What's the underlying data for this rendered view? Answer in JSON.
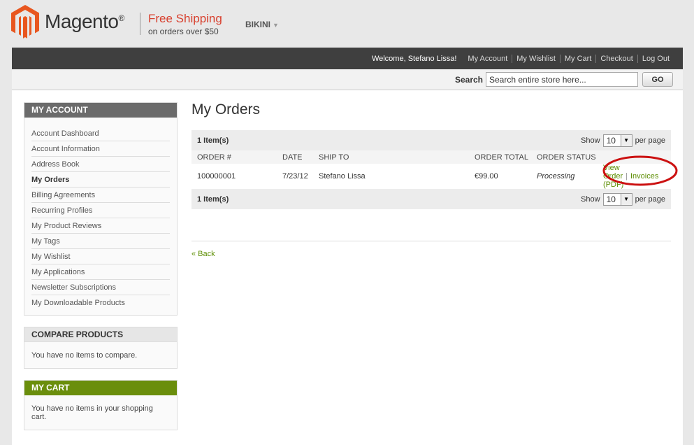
{
  "brand": {
    "name": "Magento",
    "reg": "®"
  },
  "promo": {
    "title": "Free Shipping",
    "subtitle": "on orders over $50"
  },
  "store_switcher": {
    "value": "BIKINI"
  },
  "topbar": {
    "welcome": "Welcome, Stefano Lissa!",
    "links": [
      "My Account",
      "My Wishlist",
      "My Cart",
      "Checkout",
      "Log Out"
    ]
  },
  "search": {
    "label": "Search",
    "placeholder": "Search entire store here...",
    "value": "Search entire store here...",
    "button": "GO"
  },
  "sidebar": {
    "account_title": "MY ACCOUNT",
    "account_items": [
      "Account Dashboard",
      "Account Information",
      "Address Book",
      "My Orders",
      "Billing Agreements",
      "Recurring Profiles",
      "My Product Reviews",
      "My Tags",
      "My Wishlist",
      "My Applications",
      "Newsletter Subscriptions",
      "My Downloadable Products"
    ],
    "active_item": "My Orders",
    "compare": {
      "title": "COMPARE PRODUCTS",
      "text": "You have no items to compare."
    },
    "cart": {
      "title": "MY CART",
      "text": "You have no items in your shopping cart."
    }
  },
  "main": {
    "title": "My Orders",
    "pager": {
      "count": "1 Item(s)",
      "show": "Show",
      "limit": "10",
      "per_page": "per page"
    },
    "columns": [
      "ORDER #",
      "DATE",
      "SHIP TO",
      "ORDER TOTAL",
      "ORDER STATUS"
    ],
    "rows": [
      {
        "order": "100000001",
        "date": "7/23/12",
        "ship_to": "Stefano Lissa",
        "total": "€99.00",
        "status": "Processing",
        "view": "View Order",
        "invoice": "Invoices (PDF)"
      }
    ],
    "back": "« Back"
  },
  "colors": {
    "accent_green": "#5e8f05",
    "topbar": "#3f3f3f",
    "promo_red": "#d8402e",
    "annotation_red": "#cc1111"
  }
}
